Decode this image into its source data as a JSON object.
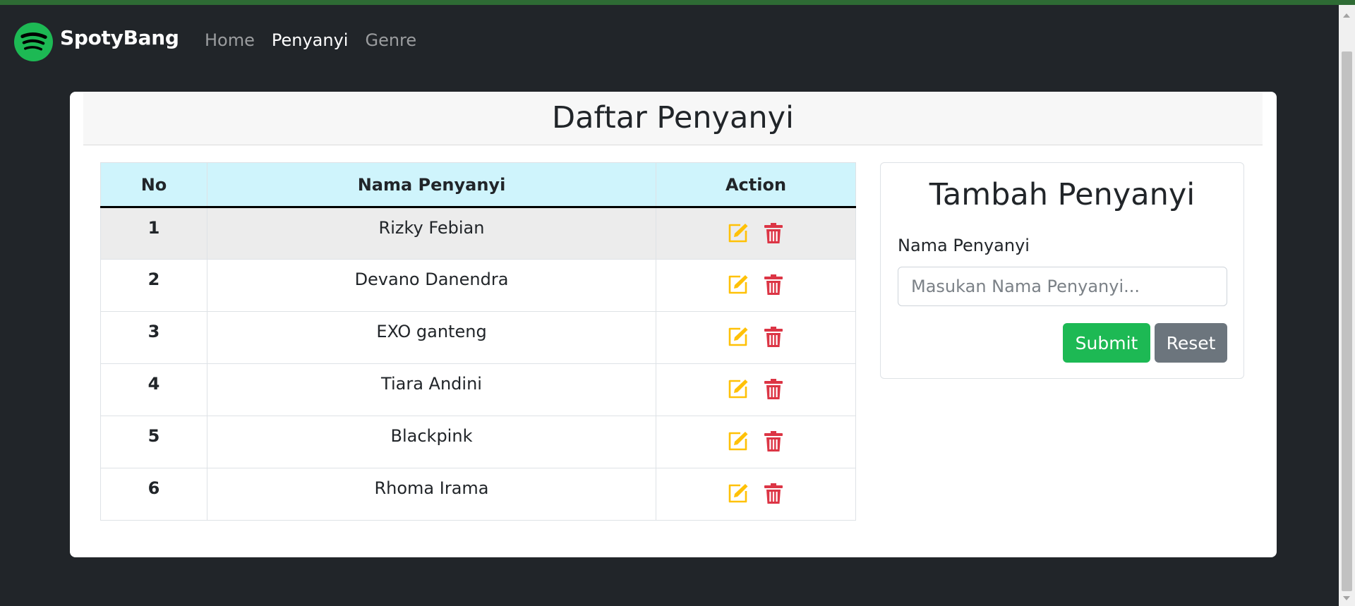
{
  "app": {
    "brand_name": "SpotyBang",
    "brand_color": "#1db954"
  },
  "nav": {
    "items": [
      {
        "label": "Home",
        "active": false
      },
      {
        "label": "Penyanyi",
        "active": true
      },
      {
        "label": "Genre",
        "active": false
      }
    ]
  },
  "page": {
    "title": "Daftar Penyanyi"
  },
  "table": {
    "headers": [
      "No",
      "Nama Penyanyi",
      "Action"
    ],
    "rows": [
      {
        "no": "1",
        "name": "Rizky Febian"
      },
      {
        "no": "2",
        "name": "Devano Danendra"
      },
      {
        "no": "3",
        "name": "EXO ganteng"
      },
      {
        "no": "4",
        "name": "Tiara Andini"
      },
      {
        "no": "5",
        "name": "Blackpink"
      },
      {
        "no": "6",
        "name": "Rhoma Irama"
      }
    ],
    "actions": [
      {
        "icon": "edit-icon",
        "color": "#ffc107"
      },
      {
        "icon": "trash-icon",
        "color": "#dc3545"
      }
    ]
  },
  "form": {
    "title": "Tambah Penyanyi",
    "label": "Nama Penyanyi",
    "placeholder": "Masukan Nama Penyanyi...",
    "value": "",
    "submit_label": "Submit",
    "reset_label": "Reset"
  }
}
